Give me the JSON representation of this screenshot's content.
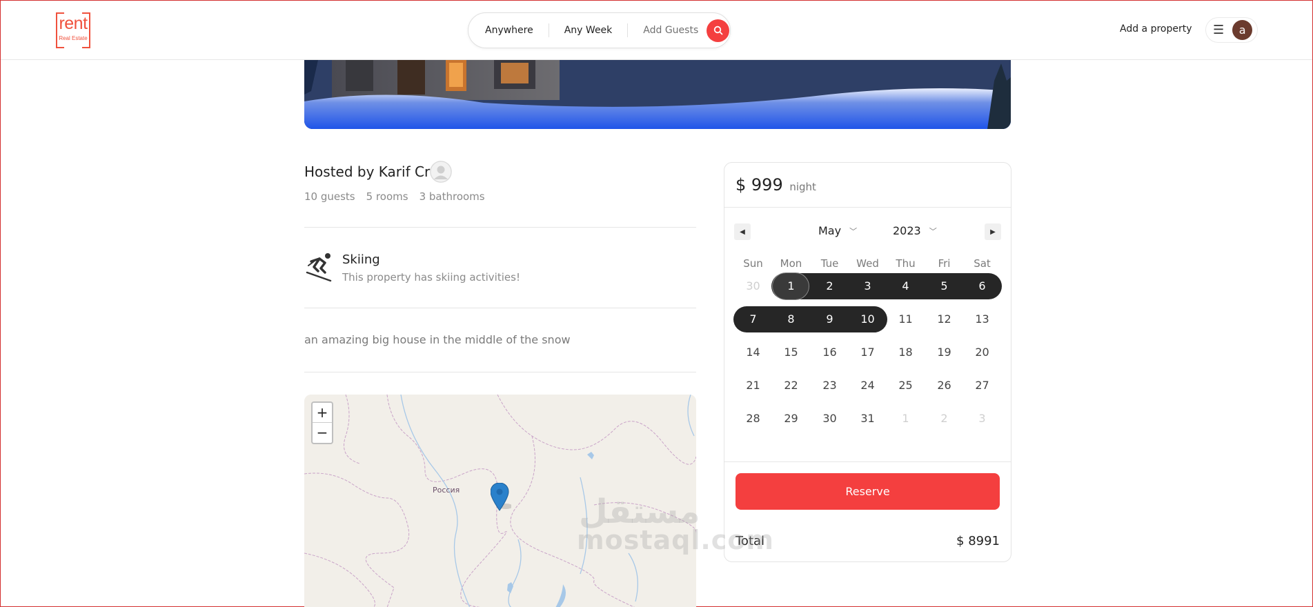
{
  "header": {
    "logo_word": "rent",
    "logo_sub": "Real Estate",
    "search": {
      "where": "Anywhere",
      "when": "Any Week",
      "guests": "Add Guests"
    },
    "add_property": "Add a property",
    "user_initial": "a",
    "menu_icon": "hamburger-icon"
  },
  "host": {
    "title": "Hosted by Karif Crf",
    "guests": "10 guests",
    "rooms": "5 rooms",
    "bathrooms": "3 bathrooms"
  },
  "feature": {
    "icon": "skiing-icon",
    "title": "Skiing",
    "description": "This property has skiing activities!"
  },
  "description": "an amazing big house in the middle of the snow",
  "map": {
    "zoom_in": "+",
    "zoom_out": "−",
    "label": "Россия"
  },
  "booking": {
    "price": "$ 999",
    "unit": "night",
    "month": "May",
    "year": "2023",
    "weekdays": [
      "Sun",
      "Mon",
      "Tue",
      "Wed",
      "Thu",
      "Fri",
      "Sat"
    ],
    "weeks": [
      [
        "30",
        "1",
        "2",
        "3",
        "4",
        "5",
        "6"
      ],
      [
        "7",
        "8",
        "9",
        "10",
        "11",
        "12",
        "13"
      ],
      [
        "14",
        "15",
        "16",
        "17",
        "18",
        "19",
        "20"
      ],
      [
        "21",
        "22",
        "23",
        "24",
        "25",
        "26",
        "27"
      ],
      [
        "28",
        "29",
        "30",
        "31",
        "1",
        "2",
        "3"
      ]
    ],
    "selected_range": [
      "1",
      "10"
    ],
    "reserve": "Reserve",
    "total_label": "Total",
    "total_value": "$ 8991"
  },
  "watermark": {
    "latin": "mostaql.com",
    "arabic": "مستقل"
  },
  "colors": {
    "brand": "#f0513d",
    "accent": "#f43f3f",
    "range": "#262626"
  }
}
